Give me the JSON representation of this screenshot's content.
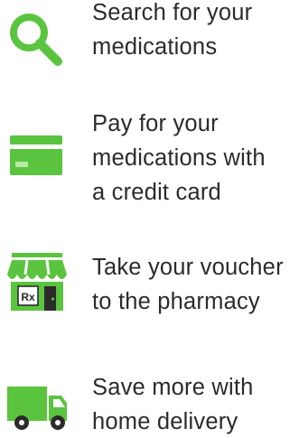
{
  "accent_color": "#5ac43e",
  "steps": [
    {
      "icon": "search-icon",
      "text": "Search for your\nmedications"
    },
    {
      "icon": "credit-card-icon",
      "text": "Pay for your\nmedications with\na credit card"
    },
    {
      "icon": "pharmacy-store-icon",
      "store_sign": "Rx",
      "text": "Take your voucher\nto the pharmacy"
    },
    {
      "icon": "delivery-truck-icon",
      "text": "Save more with\nhome delivery"
    }
  ]
}
